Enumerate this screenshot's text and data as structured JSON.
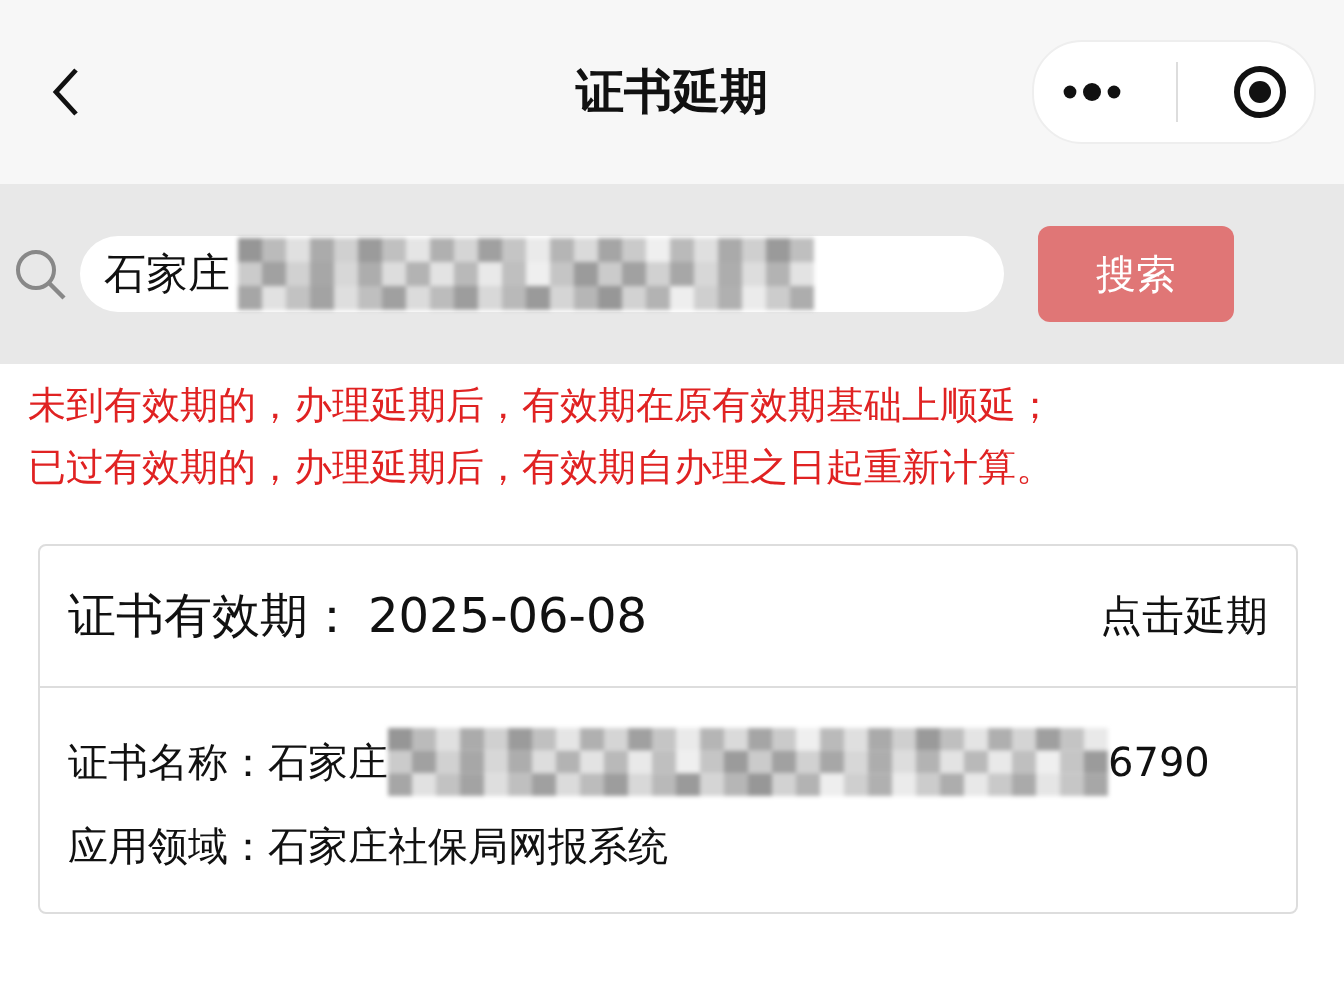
{
  "nav": {
    "title": "证书延期"
  },
  "search": {
    "value": "石家庄",
    "redacted": true,
    "button": "搜索"
  },
  "notices": [
    "未到有效期的，办理延期后，有效期在原有效期基础上顺延；",
    "已过有效期的，办理延期后，有效期自办理之日起重新计算。"
  ],
  "card": {
    "validity_label": "证书有效期：",
    "validity_date": "2025-06-08",
    "action": "点击延期",
    "fields": [
      {
        "label": "证书名称：",
        "value": "石家庄",
        "redacted": true,
        "value_end": "6790"
      },
      {
        "label": "应用领域：",
        "value": "石家庄社保局网报系统",
        "redacted": false
      }
    ]
  }
}
